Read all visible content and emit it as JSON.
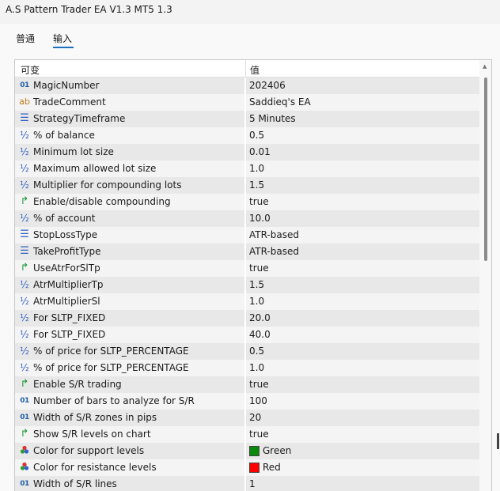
{
  "window": {
    "title": "A.S Pattern Trader EA V1.3 MT5 1.3"
  },
  "tabs": {
    "general": "普通",
    "inputs": "输入"
  },
  "table": {
    "header_variable": "可变",
    "header_value": "值",
    "rows": [
      {
        "name": "MagicNumber",
        "value": "202406",
        "icon": "int-icon"
      },
      {
        "name": "TradeComment",
        "value": "Saddieq's EA",
        "icon": "string-icon"
      },
      {
        "name": "StrategyTimeframe",
        "value": "5 Minutes",
        "icon": "enum-icon"
      },
      {
        "name": "% of balance",
        "value": "0.5",
        "icon": "double-icon"
      },
      {
        "name": "Minimum lot size",
        "value": "0.01",
        "icon": "double-icon"
      },
      {
        "name": "Maximum allowed lot size",
        "value": "1.0",
        "icon": "double-icon"
      },
      {
        "name": "Multiplier for compounding lots",
        "value": "1.5",
        "icon": "double-icon"
      },
      {
        "name": "Enable/disable compounding",
        "value": "true",
        "icon": "bool-icon"
      },
      {
        "name": "% of account",
        "value": "10.0",
        "icon": "double-icon"
      },
      {
        "name": "StopLossType",
        "value": "ATR-based",
        "icon": "enum-icon"
      },
      {
        "name": "TakeProfitType",
        "value": "ATR-based",
        "icon": "enum-icon"
      },
      {
        "name": "UseAtrForSlTp",
        "value": "true",
        "icon": "bool-icon"
      },
      {
        "name": "AtrMultiplierTp",
        "value": "1.5",
        "icon": "double-icon"
      },
      {
        "name": "AtrMultiplierSl",
        "value": "1.0",
        "icon": "double-icon"
      },
      {
        "name": "For SLTP_FIXED",
        "value": "20.0",
        "icon": "double-icon"
      },
      {
        "name": "For SLTP_FIXED",
        "value": "40.0",
        "icon": "double-icon"
      },
      {
        "name": "% of price for SLTP_PERCENTAGE",
        "value": "0.5",
        "icon": "double-icon"
      },
      {
        "name": "% of price for SLTP_PERCENTAGE",
        "value": "1.0",
        "icon": "double-icon"
      },
      {
        "name": "Enable S/R trading",
        "value": "true",
        "icon": "bool-icon"
      },
      {
        "name": "Number of bars to analyze for S/R",
        "value": "100",
        "icon": "int-icon"
      },
      {
        "name": "Width of S/R zones in pips",
        "value": "20",
        "icon": "int-icon"
      },
      {
        "name": "Show S/R levels on chart",
        "value": "true",
        "icon": "bool-icon"
      },
      {
        "name": "Color for support levels",
        "value": "Green",
        "icon": "color-icon",
        "swatch": "#0a8a0a"
      },
      {
        "name": "Color for resistance levels",
        "value": "Red",
        "icon": "color-icon",
        "swatch": "#ff0000"
      },
      {
        "name": "Width of S/R lines",
        "value": "1",
        "icon": "int-icon"
      }
    ]
  },
  "icon_glyphs": {
    "int": "01",
    "string": "ab",
    "enum": "☰",
    "double": "½",
    "bool": "↱",
    "color": "♣"
  }
}
